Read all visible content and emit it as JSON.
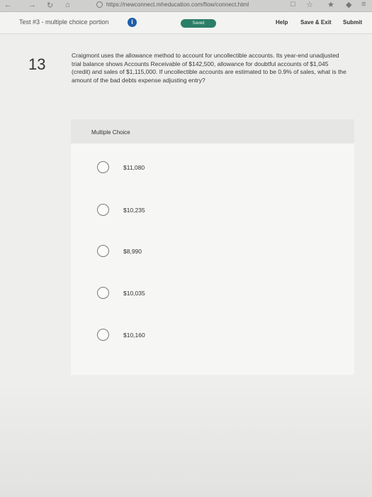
{
  "browser": {
    "url": "https://newconnect.mheducation.com/flow/connect.html"
  },
  "header": {
    "test_title": "Test #3 - multiple choice portion",
    "info_glyph": "i",
    "saved_label": "Saved",
    "help_label": "Help",
    "save_exit_label": "Save & Exit",
    "submit_label": "Submit"
  },
  "question": {
    "number": "13",
    "text": "Craigmont uses the allowance method to account for uncollectible accounts. Its year-end unadjusted trial balance shows Accounts Receivable of $142,500, allowance for doubtful accounts of $1,045 (credit) and sales of $1,115,000. If uncollectible accounts are estimated to be 0.9% of sales, what is the amount of the bad debts expense adjusting entry?"
  },
  "choices": {
    "header": "Multiple Choice",
    "options": [
      {
        "label": "$11,080"
      },
      {
        "label": "$10,235"
      },
      {
        "label": "$8,990"
      },
      {
        "label": "$10,035"
      },
      {
        "label": "$10,160"
      }
    ]
  },
  "icons": [
    "back-icon",
    "forward-icon",
    "reload-icon",
    "home-icon",
    "lock-icon",
    "star-icon",
    "info-icon",
    "radio-icon"
  ]
}
